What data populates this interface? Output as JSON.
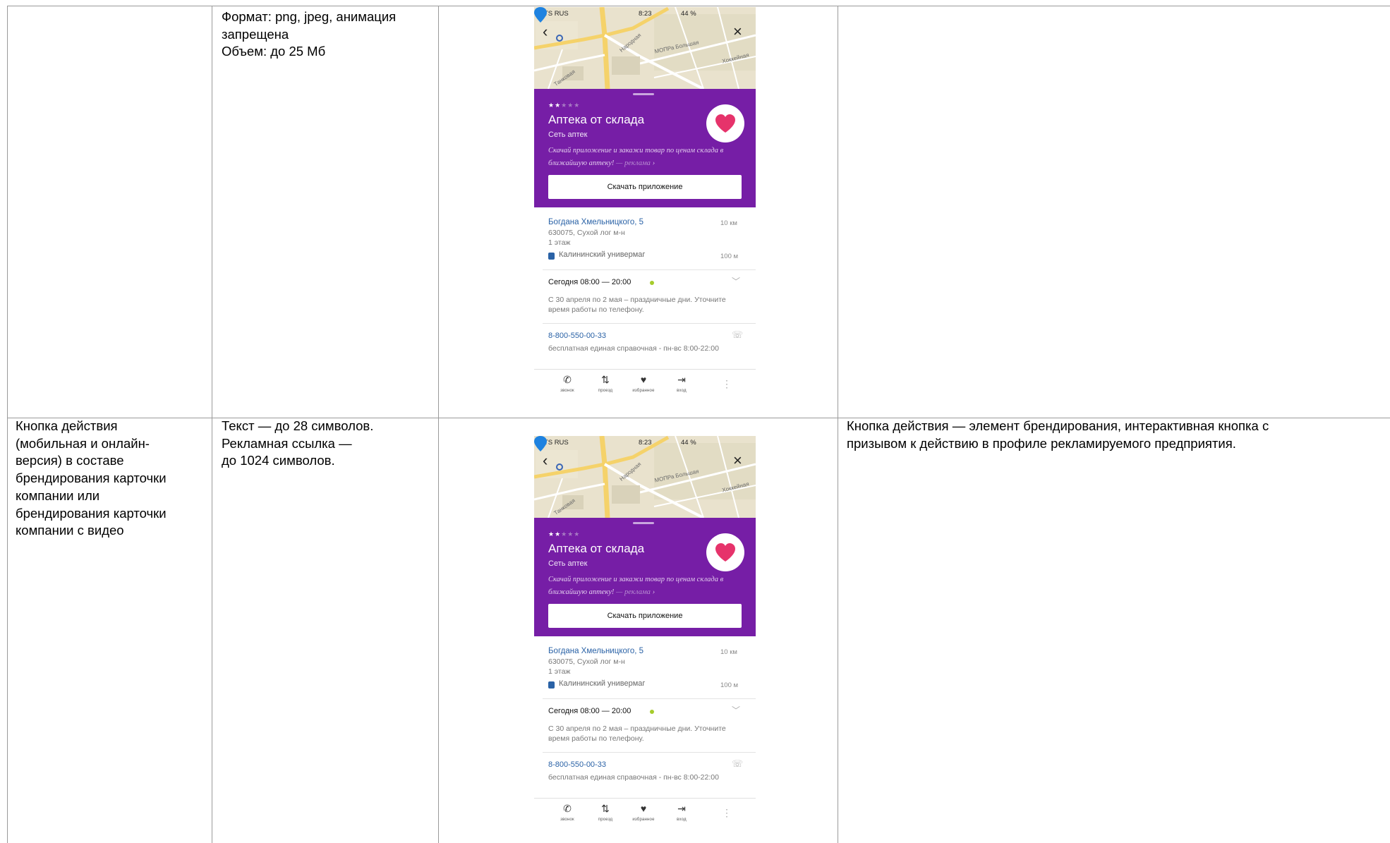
{
  "rows": [
    {
      "col1": "",
      "col2": "Формат: png, jpeg, анимация\nзапрещена\nОбъем: до 25 Мб",
      "col4": ""
    },
    {
      "col1": "Кнопка действия\n(мобильная и онлайн-\nверсия) в составе\nбрендирования карточки\nкомпании или\nбрендирования карточки\nкомпании с видео",
      "col2": "Текст — до 28 символов.\nРекламная ссылка —\nдо 1024 символов.",
      "col4": "Кнопка действия — элемент брендирования, интерактивная кнопка с\nпризывом к действию в профиле рекламируемого предприятия."
    }
  ],
  "mockup": {
    "status": {
      "carrier": "MTS RUS",
      "time": "8:23",
      "battery": "44 %"
    },
    "map_labels": [
      "Народная",
      "МОПРа Большая",
      "Хоккейная",
      "Танковая"
    ],
    "rating_stars": 2.5,
    "rating_max": 5,
    "title": "Аптека от склада",
    "subtitle": "Сеть аптек",
    "ad_text": "Скачай приложение и закажи товар по ценам склада в ближайшую аптеку!",
    "ad_tag": "— реклама",
    "cta_label": "Скачать приложение",
    "address": "Богдана Хмельницкого, 5",
    "distance_address": "10 км",
    "address_line2": "630075, Сухой лог м-н",
    "floor": "1 этаж",
    "stop_name": "Калининский универмаг",
    "distance_stop": "100 м",
    "hours": "Сегодня 08:00 — 20:00",
    "holiday_note": "С 30 апреля по 2 мая – праздничные дни. Уточните время работы по телефону.",
    "phone": "8-800-550-00-33",
    "phone_note": "бесплатная единая справочная - пн-вс 8:00-22:00",
    "tabs": [
      "звонок",
      "проезд",
      "избранное",
      "вход"
    ],
    "colors": {
      "brand_purple": "#761ea6",
      "link_blue": "#2a62a6",
      "heart_pink": "#e6336b",
      "open_green": "#a6cc2c"
    },
    "icons": [
      "back-icon",
      "close-icon",
      "map-pin-icon",
      "heart-icon",
      "bus-icon",
      "chevron-down-icon",
      "phone-icon",
      "route-icon",
      "login-icon",
      "more-icon"
    ]
  }
}
